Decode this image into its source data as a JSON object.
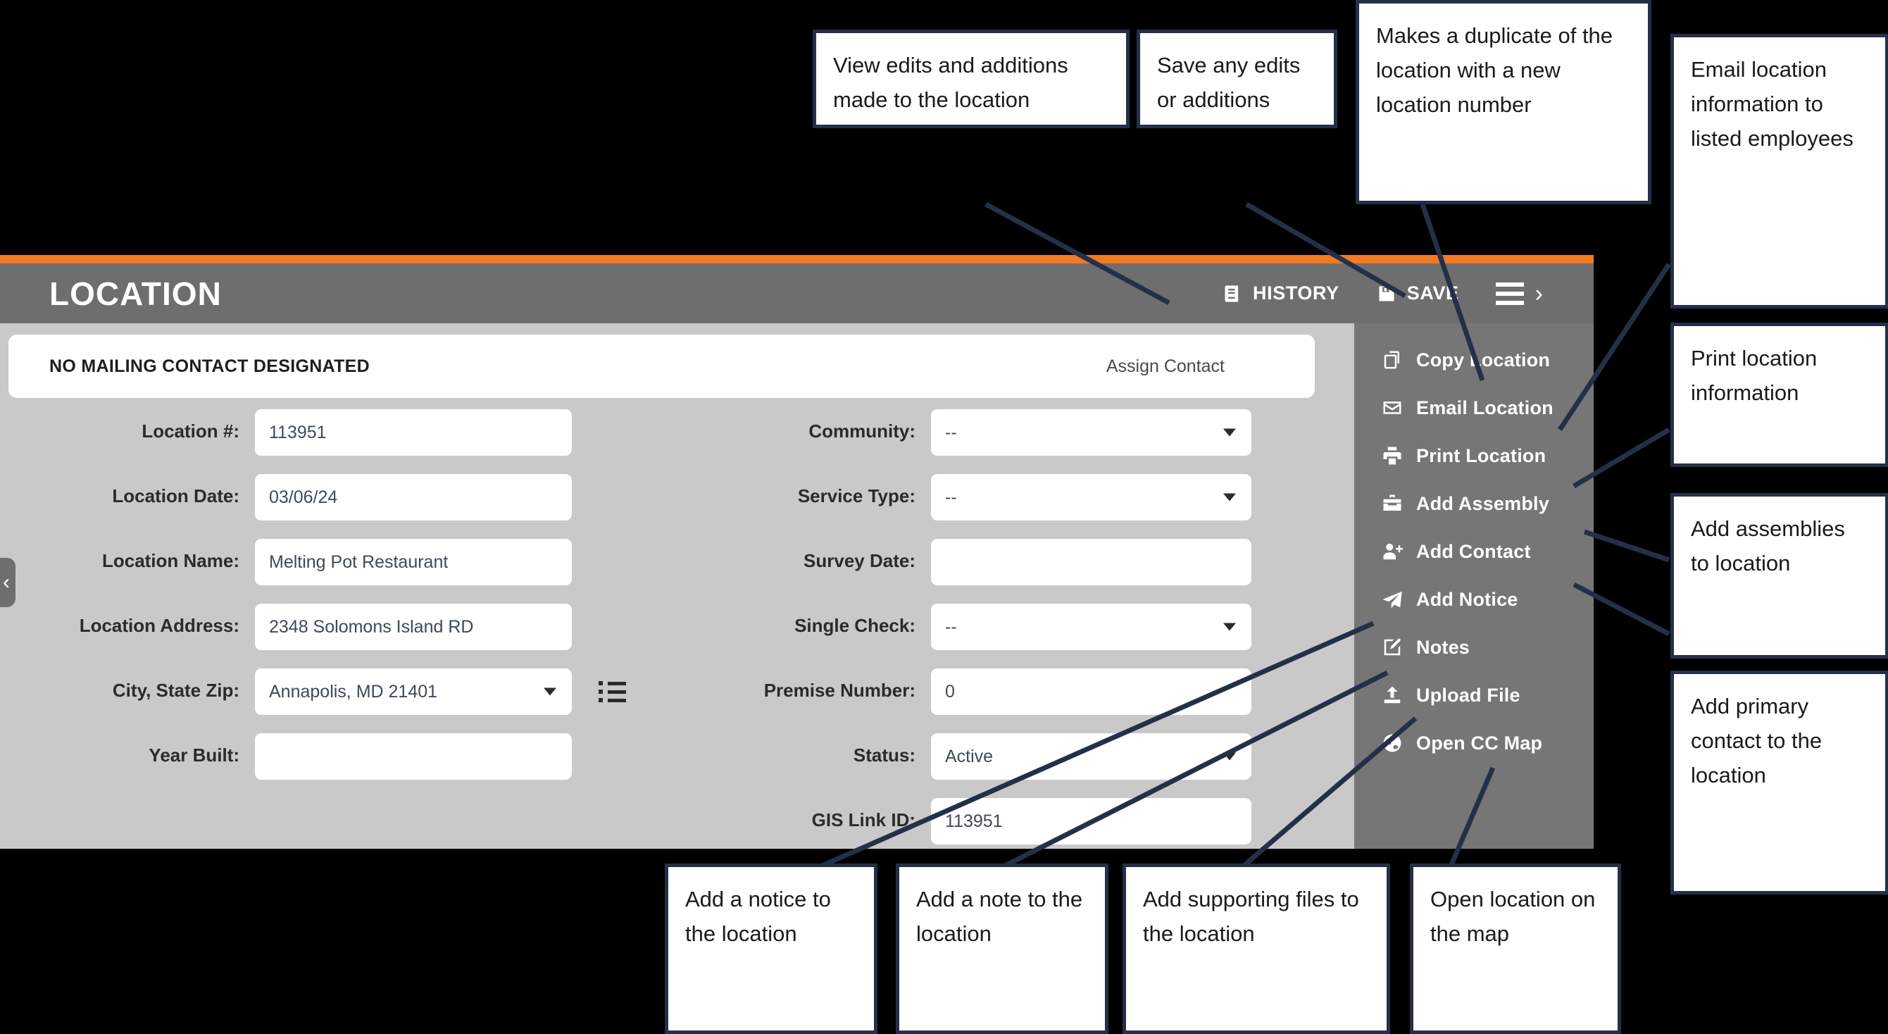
{
  "app": {
    "title": "LOCATION",
    "accent_orange": "#f47a20",
    "titlebar_color": "#6e6e6e",
    "sidebar_color": "#767676",
    "body_color": "#c9c9c9",
    "toolbar": [
      {
        "label": "HISTORY",
        "icon": "history-book-icon"
      },
      {
        "label": "SAVE",
        "icon": "save-disk-icon"
      }
    ],
    "menu_toggle_icon": "hamburger-icon",
    "menu_expand_icon": "chevron-right-icon",
    "collapse_handle_icon": "chevron-left-icon"
  },
  "contact_bar": {
    "message": "NO MAILING CONTACT DESIGNATED",
    "assign_label": "Assign Contact"
  },
  "form": {
    "left": [
      {
        "label": "Location #:",
        "value": "113951",
        "type": "text"
      },
      {
        "label": "Location Date:",
        "value": "03/06/24",
        "type": "text"
      },
      {
        "label": "Location Name:",
        "value": "Melting Pot Restaurant",
        "type": "text"
      },
      {
        "label": "Location Address:",
        "value": "2348 Solomons Island RD",
        "type": "text"
      },
      {
        "label": "City, State Zip:",
        "value": "Annapolis, MD 21401",
        "type": "select"
      },
      {
        "label": "Year Built:",
        "value": "",
        "type": "text"
      }
    ],
    "right": [
      {
        "label": "Community:",
        "value": "--",
        "type": "select"
      },
      {
        "label": "Service Type:",
        "value": "--",
        "type": "select"
      },
      {
        "label": "Survey Date:",
        "value": "",
        "type": "text"
      },
      {
        "label": "Single Check:",
        "value": "--",
        "type": "select"
      },
      {
        "label": "Premise Number:",
        "value": "0",
        "type": "text"
      },
      {
        "label": "Status:",
        "value": "Active",
        "type": "select"
      },
      {
        "label": "GIS Link ID:",
        "value": "113951",
        "type": "text"
      }
    ]
  },
  "action_menu": [
    {
      "label": "Copy Location",
      "icon": "copy-icon"
    },
    {
      "label": "Email Location",
      "icon": "envelope-icon"
    },
    {
      "label": "Print Location",
      "icon": "printer-icon"
    },
    {
      "label": "Add Assembly",
      "icon": "toolbox-icon"
    },
    {
      "label": "Add Contact",
      "icon": "user-plus-icon"
    },
    {
      "label": "Add Notice",
      "icon": "paper-plane-icon"
    },
    {
      "label": "Notes",
      "icon": "pencil-square-icon"
    },
    {
      "label": "Upload File",
      "icon": "upload-icon"
    },
    {
      "label": "Open CC Map",
      "icon": "globe-icon"
    }
  ],
  "callouts": [
    {
      "id": "history",
      "text": "View edits and additions made to the location"
    },
    {
      "id": "save",
      "text": "Save any edits or additions"
    },
    {
      "id": "copy",
      "text": "Makes a duplicate of the location with a new location number"
    },
    {
      "id": "email",
      "text": "Email location information to listed employees"
    },
    {
      "id": "print",
      "text": "Print location information"
    },
    {
      "id": "assembly",
      "text": "Add assemblies to location"
    },
    {
      "id": "contact",
      "text": "Add primary contact to the location"
    },
    {
      "id": "notice",
      "text": "Add a notice to the location"
    },
    {
      "id": "note",
      "text": "Add a note to the location"
    },
    {
      "id": "upload",
      "text": "Add supporting files to the location"
    },
    {
      "id": "map",
      "text": "Open location on the map"
    }
  ],
  "connector_color": "#24304a"
}
